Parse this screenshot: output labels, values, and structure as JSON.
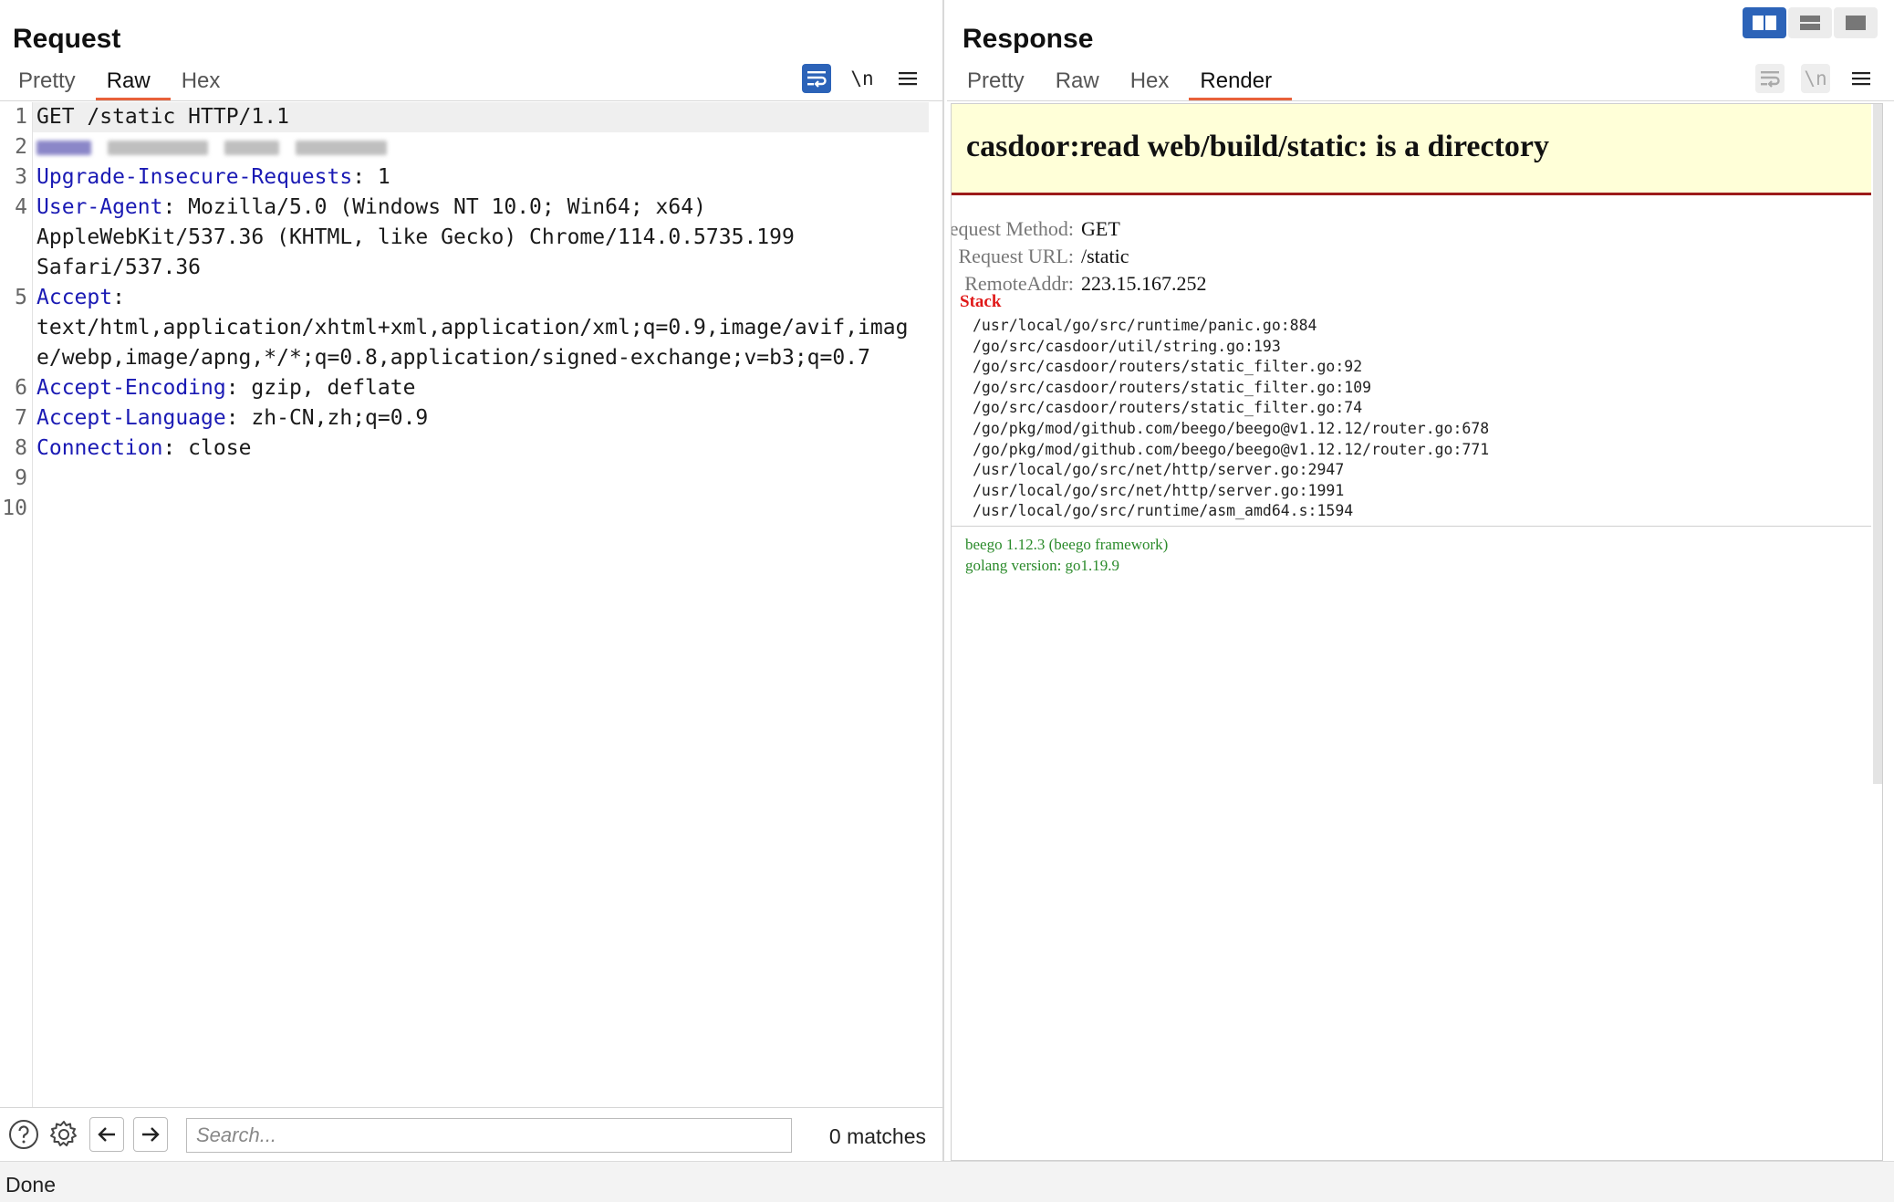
{
  "layout_toggle": {
    "selected": "side-by-side"
  },
  "request": {
    "title": "Request",
    "tabs": [
      {
        "label": "Pretty",
        "active": false
      },
      {
        "label": "Raw",
        "active": true
      },
      {
        "label": "Hex",
        "active": false
      }
    ],
    "tools": [
      "word-wrap-icon",
      "newline-icon",
      "menu-icon"
    ],
    "lines": [
      {
        "n": "1",
        "parts": [
          {
            "t": "GET /static HTTP/1.1",
            "c": "plain"
          }
        ]
      },
      {
        "n": "2",
        "parts": []
      },
      {
        "n": "3",
        "parts": [
          {
            "t": "Upgrade-Insecure-Requests",
            "c": "key"
          },
          {
            "t": ": 1",
            "c": "plain"
          }
        ]
      },
      {
        "n": "4",
        "parts": [
          {
            "t": "User-Agent",
            "c": "key"
          },
          {
            "t": ": Mozilla/5.0 (Windows NT 10.0; Win64; x64)",
            "c": "plain"
          }
        ]
      },
      {
        "n": "",
        "parts": [
          {
            "t": "AppleWebKit/537.36 (KHTML, like Gecko) Chrome/114.0.5735.199",
            "c": "plain"
          }
        ]
      },
      {
        "n": "",
        "parts": [
          {
            "t": "Safari/537.36",
            "c": "plain"
          }
        ]
      },
      {
        "n": "5",
        "parts": [
          {
            "t": "Accept",
            "c": "key"
          },
          {
            "t": ":",
            "c": "plain"
          }
        ]
      },
      {
        "n": "",
        "parts": [
          {
            "t": "text/html,application/xhtml+xml,application/xml;q=0.9,image/avif,imag",
            "c": "plain"
          }
        ]
      },
      {
        "n": "",
        "parts": [
          {
            "t": "e/webp,image/apng,*/*;q=0.8,application/signed-exchange;v=b3;q=0.7",
            "c": "plain"
          }
        ]
      },
      {
        "n": "6",
        "parts": [
          {
            "t": "Accept-Encoding",
            "c": "key"
          },
          {
            "t": ": gzip, deflate",
            "c": "plain"
          }
        ]
      },
      {
        "n": "7",
        "parts": [
          {
            "t": "Accept-Language",
            "c": "key"
          },
          {
            "t": ": zh-CN,zh;q=0.9",
            "c": "plain"
          }
        ]
      },
      {
        "n": "8",
        "parts": [
          {
            "t": "Connection",
            "c": "key"
          },
          {
            "t": ": close",
            "c": "plain"
          }
        ]
      },
      {
        "n": "9",
        "parts": []
      },
      {
        "n": "10",
        "parts": []
      }
    ],
    "search": {
      "placeholder": "Search...",
      "value": ""
    },
    "matches": "0 matches"
  },
  "response": {
    "title": "Response",
    "tabs": [
      {
        "label": "Pretty",
        "active": false
      },
      {
        "label": "Raw",
        "active": false
      },
      {
        "label": "Hex",
        "active": false
      },
      {
        "label": "Render",
        "active": true
      }
    ],
    "render": {
      "error_title": "casdoor:read web/build/static: is a directory",
      "fields": [
        {
          "k": "Request Method:",
          "v": "GET"
        },
        {
          "k": "Request URL:",
          "v": "/static"
        },
        {
          "k": "RemoteAddr:",
          "v": "223.15.167.252"
        }
      ],
      "stack_label": "Stack",
      "stack": [
        "/usr/local/go/src/runtime/panic.go:884",
        "/go/src/casdoor/util/string.go:193",
        "/go/src/casdoor/routers/static_filter.go:92",
        "/go/src/casdoor/routers/static_filter.go:109",
        "/go/src/casdoor/routers/static_filter.go:74",
        "/go/pkg/mod/github.com/beego/beego@v1.12.12/router.go:678",
        "/go/pkg/mod/github.com/beego/beego@v1.12.12/router.go:771",
        "/usr/local/go/src/net/http/server.go:2947",
        "/usr/local/go/src/net/http/server.go:1991",
        "/usr/local/go/src/runtime/asm_amd64.s:1594"
      ],
      "footer": [
        "beego 1.12.3 (beego framework)",
        "golang version: go1.19.9"
      ]
    }
  },
  "status": "Done"
}
